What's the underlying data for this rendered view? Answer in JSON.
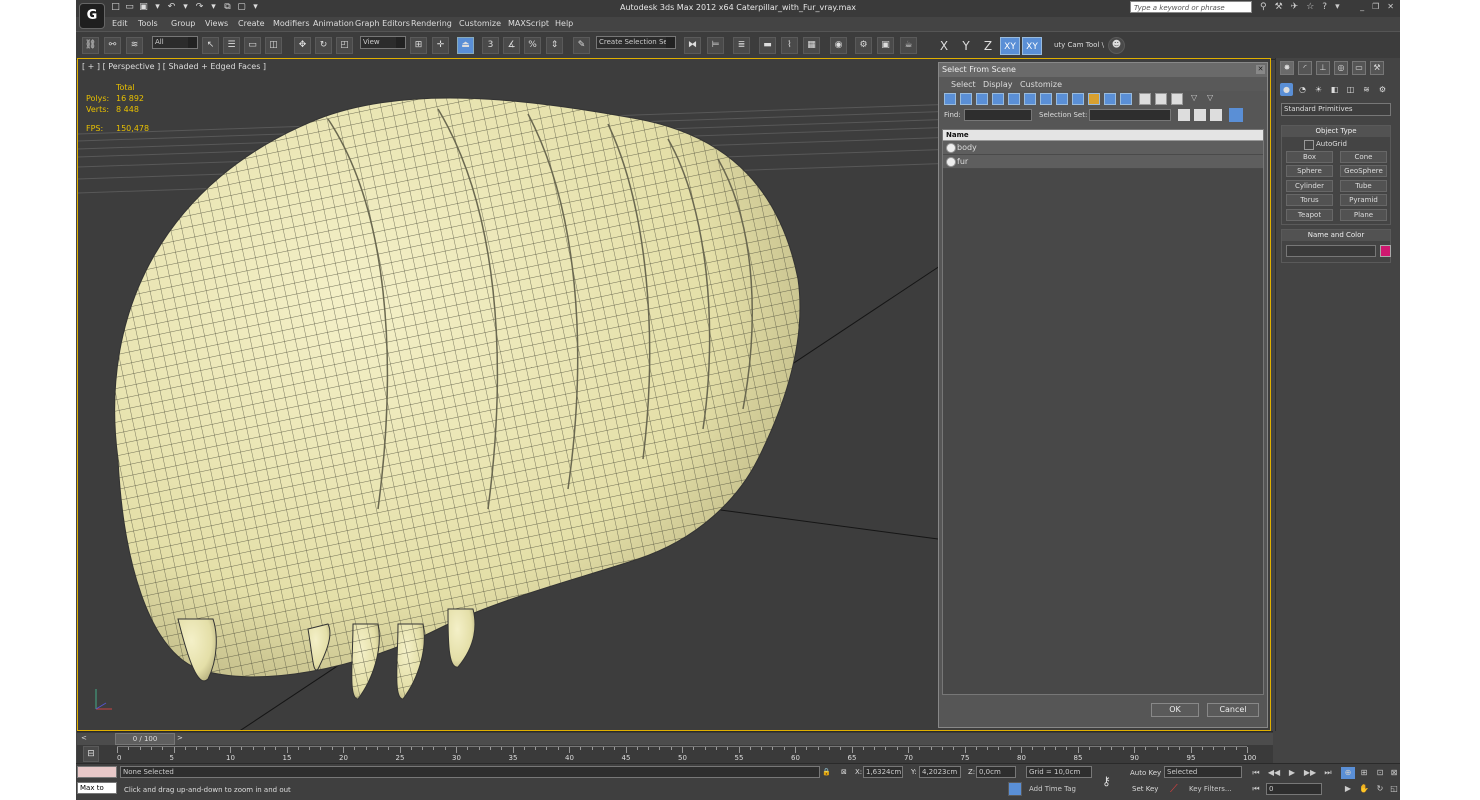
{
  "app": {
    "logo": "G",
    "title": "Autodesk 3ds Max  2012 x64     Caterpillar_with_Fur_vray.max",
    "search_placeholder": "Type a keyword or phrase"
  },
  "menu": [
    "Edit",
    "Tools",
    "Group",
    "Views",
    "Create",
    "Modifiers",
    "Animation",
    "Graph Editors",
    "Rendering",
    "Customize",
    "MAXScript",
    "Help"
  ],
  "toolbar": {
    "filter_all": "All",
    "ref_view": "View",
    "snap_3": "3",
    "create_selection_set": "Create Selection Se",
    "axis_x": "X",
    "axis_y": "Y",
    "axis_z": "Z",
    "axis_xy": "XY",
    "axis_xy2": "XY",
    "cam_tool": "uty Cam Tool \\"
  },
  "viewport": {
    "label": "[ + ] [ Perspective ] [ Shaded + Edged Faces ]",
    "stats_total": "Total",
    "polys_label": "Polys:",
    "polys_value": "16 892",
    "verts_label": "Verts:",
    "verts_value": "8 448",
    "fps_label": "FPS:",
    "fps_value": "150,478"
  },
  "select_dialog": {
    "title": "Select From Scene",
    "menu": [
      "Select",
      "Display",
      "Customize"
    ],
    "find_label": "Find:",
    "selection_set_label": "Selection Set:",
    "column_name": "Name",
    "items": [
      "body",
      "fur"
    ],
    "ok": "OK",
    "cancel": "Cancel"
  },
  "command_panel": {
    "category": "Standard Primitives",
    "object_type_title": "Object Type",
    "autogrid": "AutoGrid",
    "primitives": [
      "Box",
      "Cone",
      "Sphere",
      "GeoSphere",
      "Cylinder",
      "Tube",
      "Torus",
      "Pyramid",
      "Teapot",
      "Plane"
    ],
    "name_color_title": "Name and Color",
    "swatch_color": "#d01870"
  },
  "timeline": {
    "slider": "0 / 100",
    "ticks": [
      "0",
      "5",
      "10",
      "15",
      "20",
      "25",
      "30",
      "35",
      "40",
      "45",
      "50",
      "55",
      "60",
      "65",
      "70",
      "75",
      "80",
      "85",
      "90",
      "95",
      "100"
    ]
  },
  "status": {
    "maxscript": "Max to",
    "selection": "None Selected",
    "prompt": "Click and drag up-and-down to zoom in and out",
    "x_label": "X:",
    "x_value": "1,6324cm",
    "y_label": "Y:",
    "y_value": "4,2023cm",
    "z_label": "Z:",
    "z_value": "0,0cm",
    "grid": "Grid = 10,0cm",
    "add_time_tag": "Add Time Tag",
    "auto_key": "Auto Key",
    "selected": "Selected",
    "set_key": "Set Key",
    "key_filters": "Key Filters...",
    "frame": "0"
  }
}
